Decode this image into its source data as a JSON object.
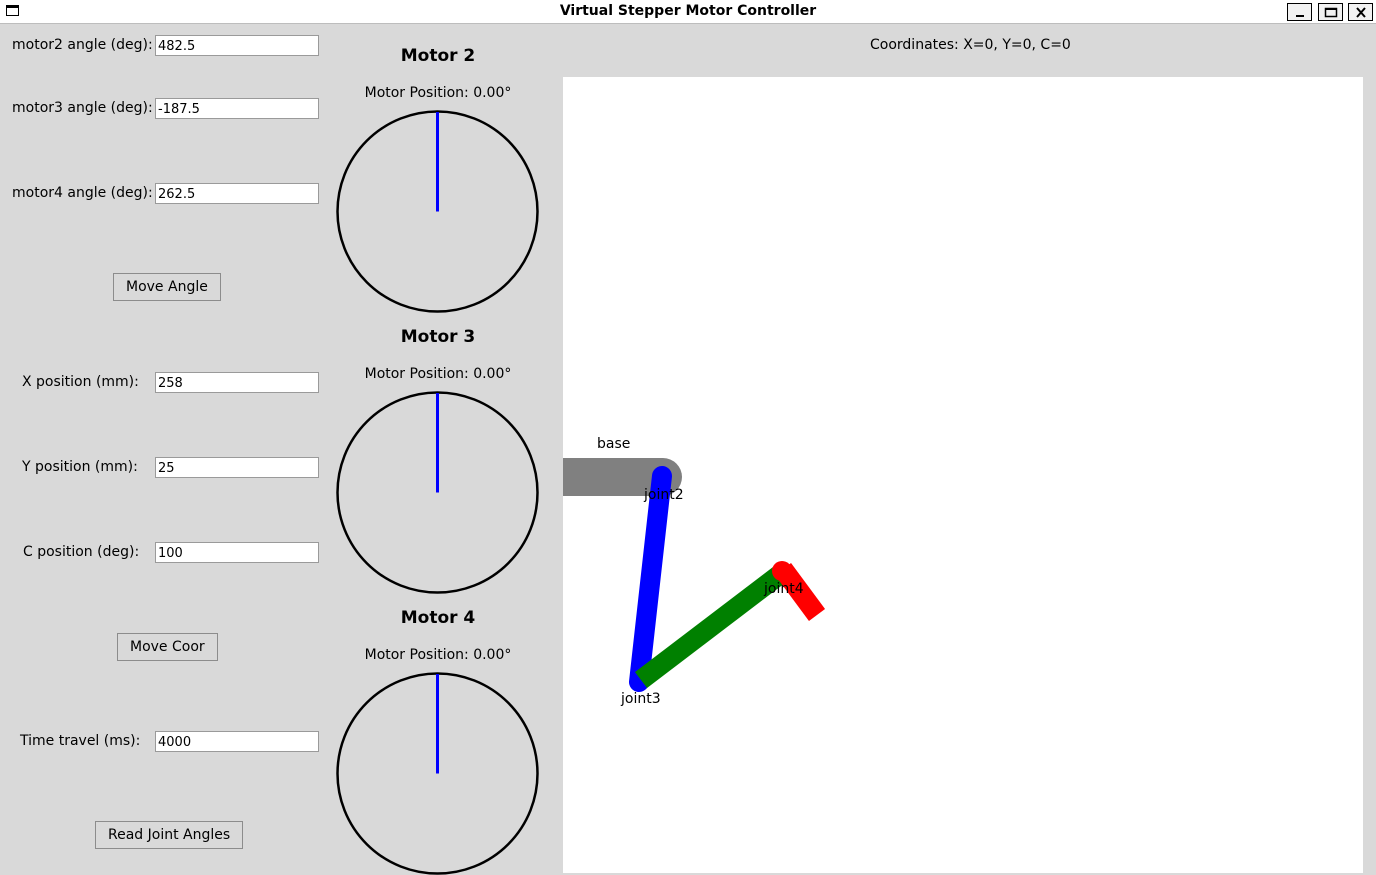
{
  "window": {
    "title": "Virtual Stepper Motor Controller",
    "icons": [
      "window-icon",
      "minimize-icon",
      "maximize-icon",
      "close-icon"
    ]
  },
  "angle_inputs": [
    {
      "label": "motor2 angle (deg):",
      "value": "482.5"
    },
    {
      "label": "motor3 angle (deg):",
      "value": "-187.5"
    },
    {
      "label": "motor4 angle (deg):",
      "value": "262.5"
    }
  ],
  "move_angle_label": "Move Angle",
  "coord_inputs": [
    {
      "label": "X position (mm):",
      "value": "258"
    },
    {
      "label": "Y position (mm):",
      "value": "25"
    },
    {
      "label": "C position (deg):",
      "value": "100"
    }
  ],
  "move_coor_label": "Move Coor",
  "time_input": {
    "label": "Time travel (ms):",
    "value": "4000"
  },
  "read_angles_label": "Read Joint Angles",
  "motors": [
    {
      "title": "Motor 2",
      "position_text": "Motor Position: 0.00°",
      "position_deg": 0
    },
    {
      "title": "Motor 3",
      "position_text": "Motor Position: 0.00°",
      "position_deg": 0
    },
    {
      "title": "Motor 4",
      "position_text": "Motor Position: 0.00°",
      "position_deg": 0
    }
  ],
  "coordinates_text": "Coordinates: X=0, Y=0, C=0",
  "arm": {
    "labels": {
      "base": "base",
      "joint2": "joint2",
      "joint3": "joint3",
      "joint4": "joint4"
    },
    "colors": {
      "base": "#808080",
      "link1": "#0000ff",
      "link2": "#008000",
      "link3": "#ff0000",
      "needle": "#0000ff"
    }
  }
}
